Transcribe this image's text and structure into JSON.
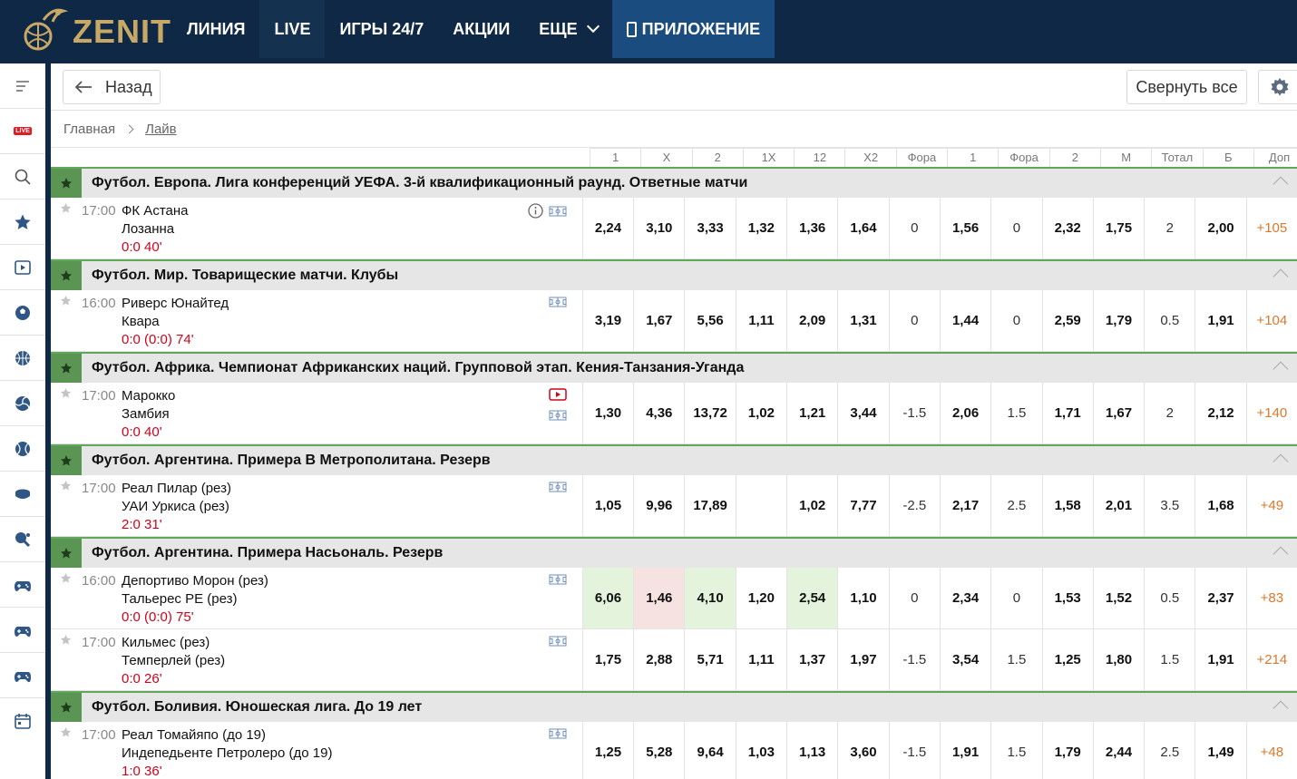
{
  "brand": {
    "name": "ZENIT"
  },
  "nav": [
    {
      "label": "ЛИНИЯ"
    },
    {
      "label": "LIVE"
    },
    {
      "label": "ИГРЫ 24/7"
    },
    {
      "label": "АКЦИИ"
    },
    {
      "label": "ЕЩЕ"
    },
    {
      "label": "ПРИЛОЖЕНИЕ"
    }
  ],
  "sidebar": {
    "live_label": "LIVE"
  },
  "toolbar": {
    "back_label": "Назад",
    "collapse_label": "Свернуть все"
  },
  "breadcrumb": {
    "home": "Главная",
    "current": "Лайв"
  },
  "columns": [
    "1",
    "X",
    "2",
    "1X",
    "12",
    "X2",
    "Фора",
    "1",
    "Фора",
    "2",
    "М",
    "Тотал",
    "Б",
    "Доп"
  ],
  "groups": [
    {
      "title": "Футбол. Европа. Лига конференций УЕФА. 3-й квалификационный раунд. Ответные матчи",
      "events": [
        {
          "time": "17:00",
          "team1": "ФК Астана",
          "team2": "Лозанна",
          "score": "0:0 40'",
          "info": true,
          "video": false,
          "odds": [
            "2,24",
            "3,10",
            "3,33",
            "1,32",
            "1,36",
            "1,64",
            "0",
            "1,56",
            "0",
            "2,32",
            "1,75",
            "2",
            "2,00",
            "+105"
          ],
          "hl": {}
        }
      ]
    },
    {
      "title": "Футбол. Мир. Товарищеские матчи. Клубы",
      "events": [
        {
          "time": "16:00",
          "team1": "Риверс Юнайтед",
          "team2": "Квара",
          "score": "0:0 (0:0) 74'",
          "info": false,
          "video": false,
          "odds": [
            "3,19",
            "1,67",
            "5,56",
            "1,11",
            "2,09",
            "1,31",
            "0",
            "1,44",
            "0",
            "2,59",
            "1,79",
            "0.5",
            "1,91",
            "+104"
          ],
          "hl": {}
        }
      ]
    },
    {
      "title": "Футбол. Африка. Чемпионат Африканских наций. Групповой этап. Кения-Танзания-Уганда",
      "events": [
        {
          "time": "17:00",
          "team1": "Марокко",
          "team2": "Замбия",
          "score": "0:0 40'",
          "info": false,
          "video": true,
          "odds": [
            "1,30",
            "4,36",
            "13,72",
            "1,02",
            "1,21",
            "3,44",
            "-1.5",
            "2,06",
            "1.5",
            "1,71",
            "1,67",
            "2",
            "2,12",
            "+140"
          ],
          "hl": {}
        }
      ]
    },
    {
      "title": "Футбол. Аргентина. Примера B Метрополитана. Резерв",
      "events": [
        {
          "time": "17:00",
          "team1": "Реал Пилар (рез)",
          "team2": "УАИ Уркиса (рез)",
          "score": "2:0 31'",
          "info": false,
          "video": false,
          "odds": [
            "1,05",
            "9,96",
            "17,89",
            "",
            "1,02",
            "7,77",
            "-2.5",
            "2,17",
            "2.5",
            "1,58",
            "2,01",
            "3.5",
            "1,68",
            "+49"
          ],
          "hl": {}
        }
      ]
    },
    {
      "title": "Футбол. Аргентина. Примера Насьональ. Резерв",
      "events": [
        {
          "time": "16:00",
          "team1": "Депортиво Морон (рез)",
          "team2": "Тальерес РЕ (рез)",
          "score": "0:0 (0:0) 75'",
          "info": false,
          "video": false,
          "odds": [
            "6,06",
            "1,46",
            "4,10",
            "1,20",
            "2,54",
            "1,10",
            "0",
            "2,34",
            "0",
            "1,53",
            "1,52",
            "0.5",
            "2,37",
            "+83"
          ],
          "hl": {
            "0": "up",
            "1": "down",
            "2": "up",
            "4": "up"
          }
        },
        {
          "time": "17:00",
          "team1": "Кильмес (рез)",
          "team2": "Темперлей (рез)",
          "score": "0:0 26'",
          "info": false,
          "video": false,
          "odds": [
            "1,75",
            "2,88",
            "5,71",
            "1,11",
            "1,37",
            "1,97",
            "-1.5",
            "3,54",
            "1.5",
            "1,25",
            "1,80",
            "1.5",
            "1,91",
            "+214"
          ],
          "hl": {}
        }
      ]
    },
    {
      "title": "Футбол. Боливия. Юношеская лига. До 19 лет",
      "events": [
        {
          "time": "17:00",
          "team1": "Реал Томайяпо (до 19)",
          "team2": "Индепедьенте Петролеро (до 19)",
          "score": "1:0 36'",
          "info": false,
          "video": false,
          "odds": [
            "1,25",
            "5,28",
            "9,64",
            "1,03",
            "1,13",
            "3,60",
            "-1.5",
            "1,91",
            "1.5",
            "1,79",
            "2,44",
            "2.5",
            "1,49",
            "+48"
          ],
          "hl": {}
        }
      ]
    }
  ],
  "colors": {
    "accent_green": "#5a9553",
    "nav_bg": "#0e2845",
    "score_red": "#d0021b",
    "more_orange": "#d9782d"
  }
}
